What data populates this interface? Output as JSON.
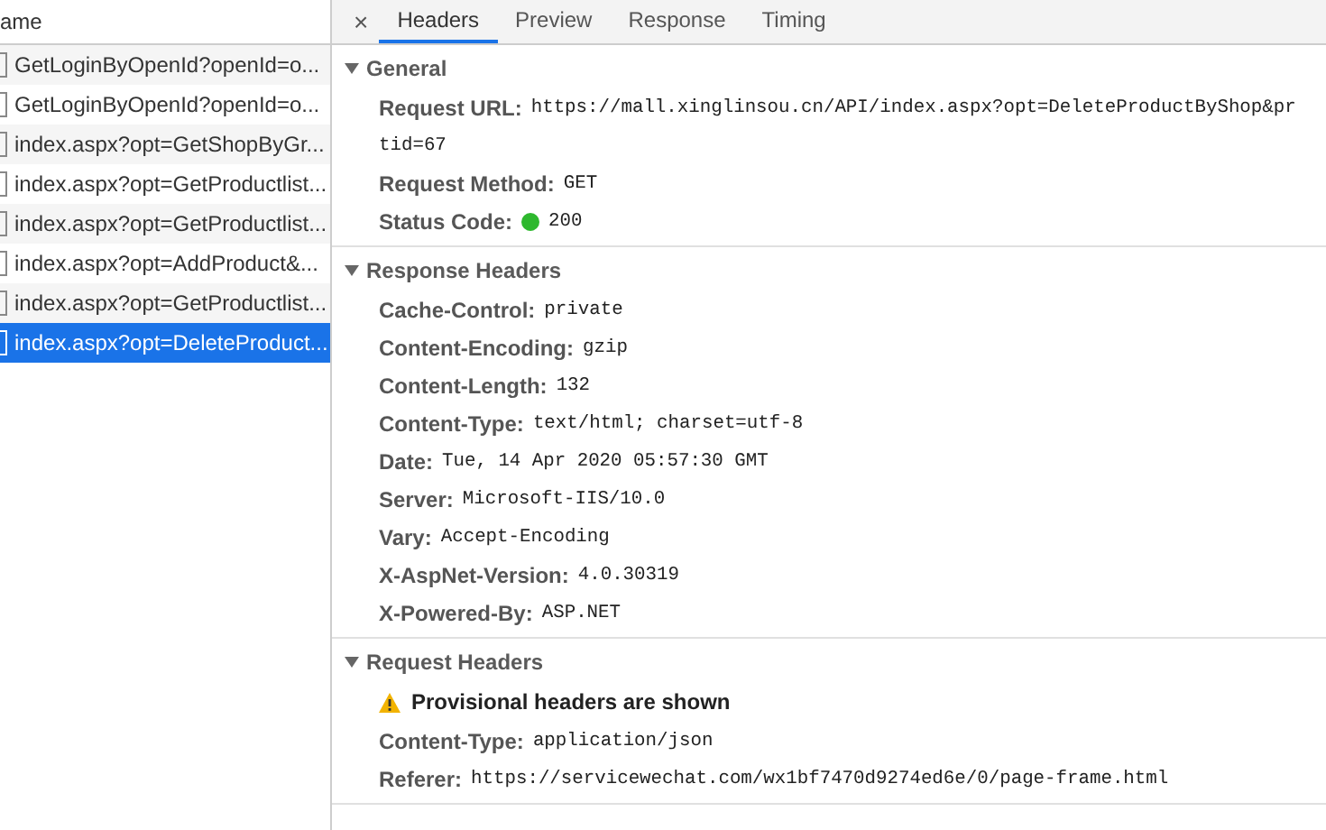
{
  "requests": {
    "column_header": "ame",
    "rows": [
      {
        "name": "GetLoginByOpenId?openId=o...",
        "selected": false
      },
      {
        "name": "GetLoginByOpenId?openId=o...",
        "selected": false
      },
      {
        "name": "index.aspx?opt=GetShopByGr...",
        "selected": false
      },
      {
        "name": "index.aspx?opt=GetProductlist...",
        "selected": false
      },
      {
        "name": "index.aspx?opt=GetProductlist...",
        "selected": false
      },
      {
        "name": "index.aspx?opt=AddProduct&...",
        "selected": false
      },
      {
        "name": "index.aspx?opt=GetProductlist...",
        "selected": false
      },
      {
        "name": "index.aspx?opt=DeleteProduct...",
        "selected": true
      }
    ]
  },
  "detail": {
    "close": "×",
    "tabs": [
      {
        "label": "Headers",
        "selected": true
      },
      {
        "label": "Preview",
        "selected": false
      },
      {
        "label": "Response",
        "selected": false
      },
      {
        "label": "Timing",
        "selected": false
      }
    ],
    "sections": [
      {
        "title": "General",
        "expanded": true,
        "items": [
          {
            "key": "Request URL:",
            "value_lines": [
              "https://mall.xinglinsou.cn/API/index.aspx?opt=DeleteProductByShop&pr",
              "tid=67"
            ]
          },
          {
            "key": "Request Method:",
            "value_lines": [
              "GET"
            ]
          },
          {
            "key": "Status Code:",
            "value_lines": [
              "200"
            ],
            "color": "#2eb82e"
          }
        ]
      },
      {
        "title": "Response Headers",
        "expanded": true,
        "items": [
          {
            "key": "Cache-Control:",
            "value_lines": [
              "private"
            ]
          },
          {
            "key": "Content-Encoding:",
            "value_lines": [
              "gzip"
            ]
          },
          {
            "key": "Content-Length:",
            "value_lines": [
              "132"
            ]
          },
          {
            "key": "Content-Type:",
            "value_lines": [
              "text/html; charset=utf-8"
            ]
          },
          {
            "key": "Date:",
            "value_lines": [
              "Tue, 14 Apr 2020 05:57:30 GMT"
            ]
          },
          {
            "key": "Server:",
            "value_lines": [
              "Microsoft-IIS/10.0"
            ]
          },
          {
            "key": "Vary:",
            "value_lines": [
              "Accept-Encoding"
            ]
          },
          {
            "key": "X-AspNet-Version:",
            "value_lines": [
              "4.0.30319"
            ]
          },
          {
            "key": "X-Powered-By:",
            "value_lines": [
              "ASP.NET"
            ]
          }
        ]
      },
      {
        "title": "Request Headers",
        "expanded": true,
        "warning": "Provisional headers are shown",
        "items": [
          {
            "key": "Content-Type:",
            "value_lines": [
              "application/json"
            ]
          },
          {
            "key": "Referer:",
            "value_lines": [
              "https://servicewechat.com/wx1bf7470d9274ed6e/0/page-frame.html"
            ]
          }
        ]
      }
    ]
  }
}
